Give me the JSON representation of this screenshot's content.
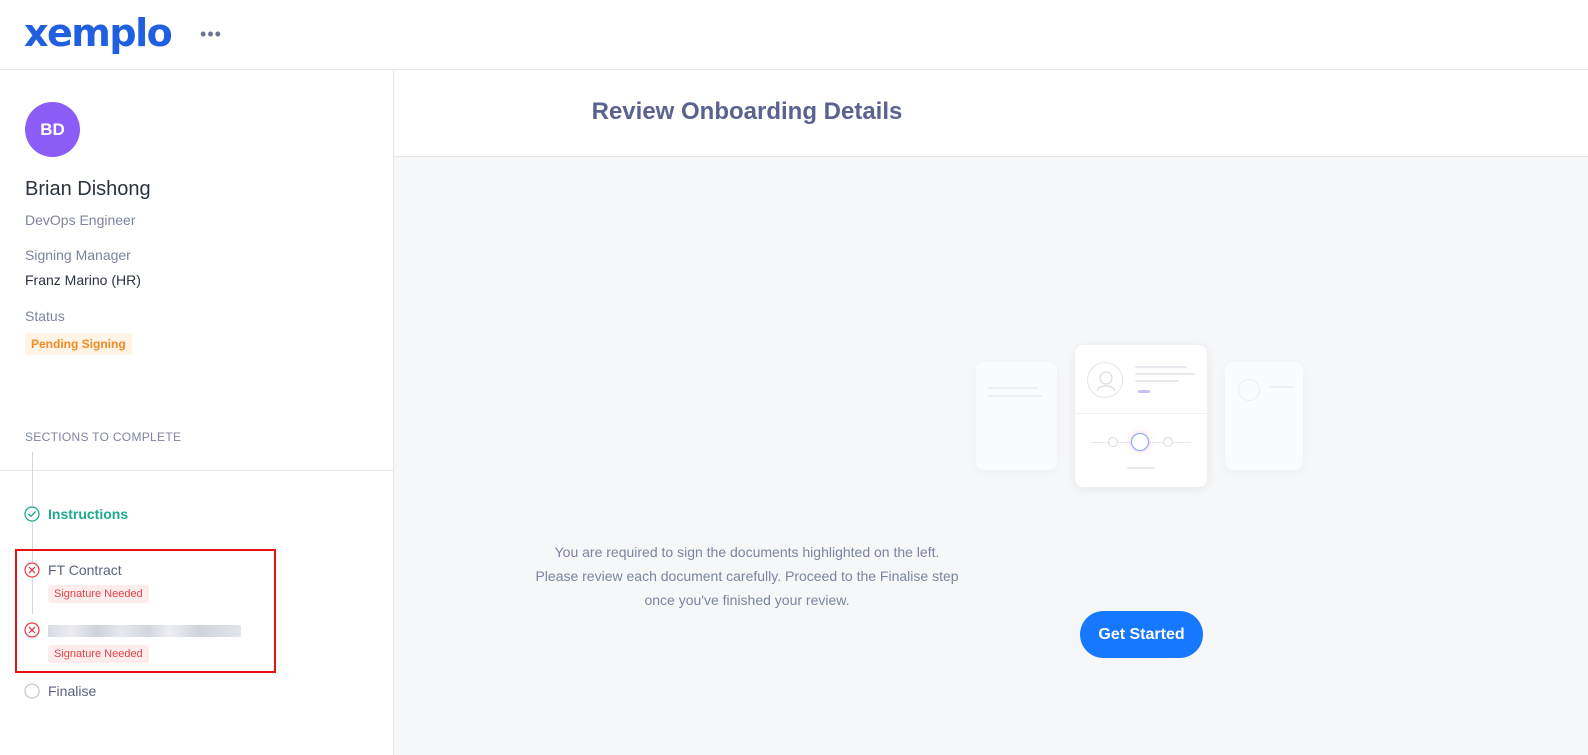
{
  "header": {
    "logo_text": "xemplo",
    "more_icon": "ellipsis-icon"
  },
  "profile": {
    "initials": "BD",
    "avatar_color": "#8b5cf6",
    "name": "Brian Dishong",
    "role": "DevOps Engineer",
    "manager_label": "Signing Manager",
    "manager_value": "Franz Marino (HR)",
    "status_label": "Status",
    "status_value": "Pending Signing"
  },
  "sections": {
    "title": "SECTIONS TO COMPLETE",
    "steps": [
      {
        "label": "Instructions",
        "state": "complete",
        "icon": "check-circle-icon"
      },
      {
        "label": "FT Contract",
        "state": "error",
        "icon": "x-circle-icon",
        "badge": "Signature Needed"
      },
      {
        "label": "",
        "state": "error",
        "icon": "x-circle-icon",
        "badge": "Signature Needed",
        "label_redacted": true
      },
      {
        "label": "Finalise",
        "state": "pending",
        "icon": "empty-circle-icon"
      }
    ]
  },
  "main": {
    "title": "Review Onboarding Details",
    "instructions": [
      "You are required to sign the documents highlighted on the left.",
      "Please review each document carefully. Proceed to the Finalise step",
      "once you've finished your review."
    ],
    "cta_label": "Get Started"
  },
  "colors": {
    "brand": "#1f5fe0",
    "accent_button": "#1677ff",
    "success": "#1fa98f",
    "error": "#e0454b",
    "warning": "#f08a24",
    "highlight_border": "#e81010"
  }
}
